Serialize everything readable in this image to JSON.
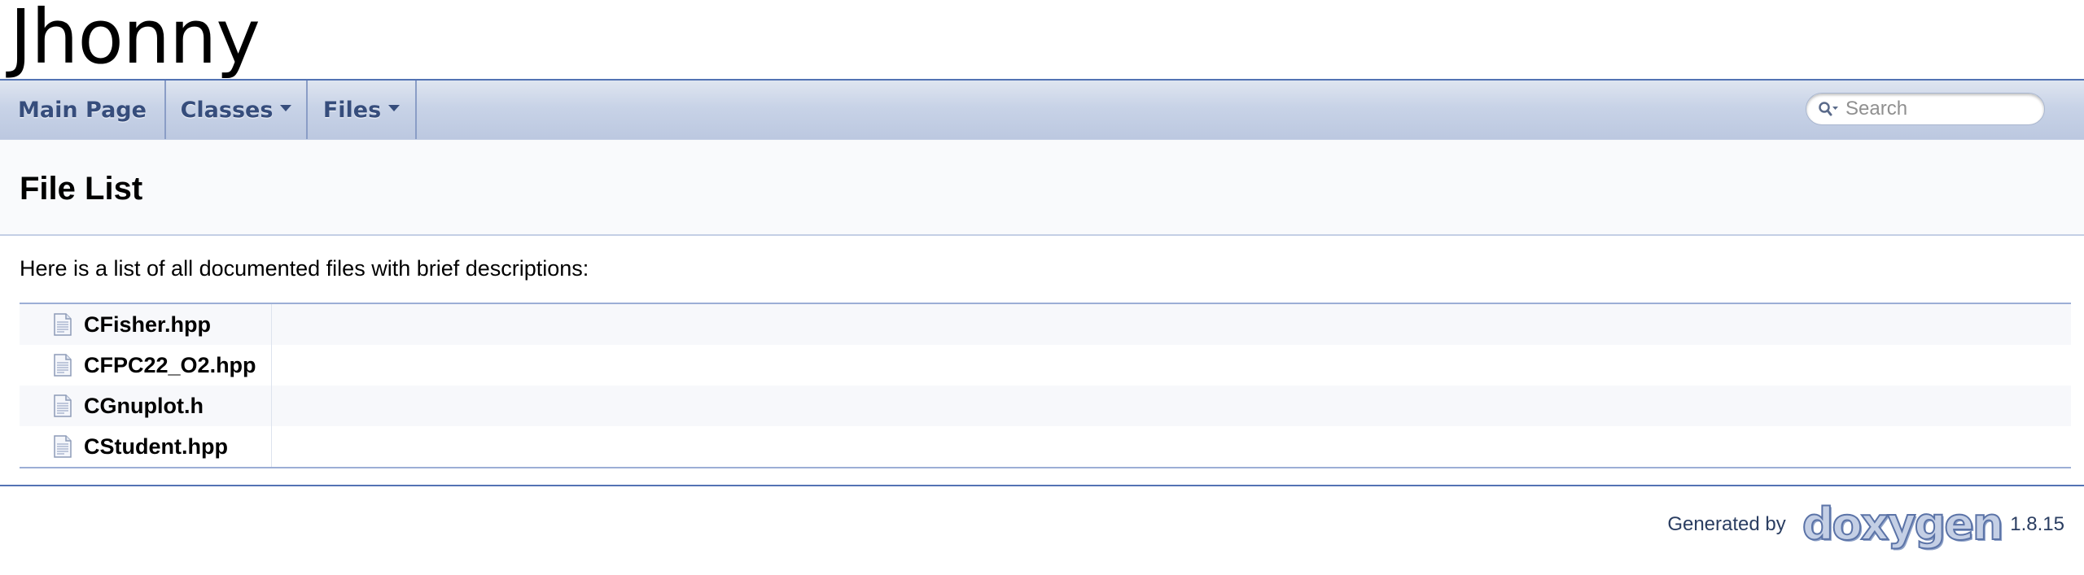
{
  "project": {
    "name": "Jhonny"
  },
  "navbar": {
    "tabs": [
      {
        "label": "Main Page",
        "has_dropdown": false
      },
      {
        "label": "Classes",
        "has_dropdown": true
      },
      {
        "label": "Files",
        "has_dropdown": true
      }
    ],
    "search": {
      "placeholder": "Search",
      "value": ""
    }
  },
  "header": {
    "title": "File List"
  },
  "content": {
    "intro": "Here is a list of all documented files with brief descriptions:",
    "files": [
      {
        "name": "CFisher.hpp",
        "description": ""
      },
      {
        "name": "CFPC22_O2.hpp",
        "description": ""
      },
      {
        "name": "CGnuplot.h",
        "description": ""
      },
      {
        "name": "CStudent.hpp",
        "description": ""
      }
    ]
  },
  "footer": {
    "generated_by": "Generated by",
    "logo_text": "doxygen",
    "version": "1.8.15"
  },
  "colors": {
    "nav_text": "#364d7c",
    "rule": "#5373b4",
    "row_alt": "#f7f8fb"
  }
}
